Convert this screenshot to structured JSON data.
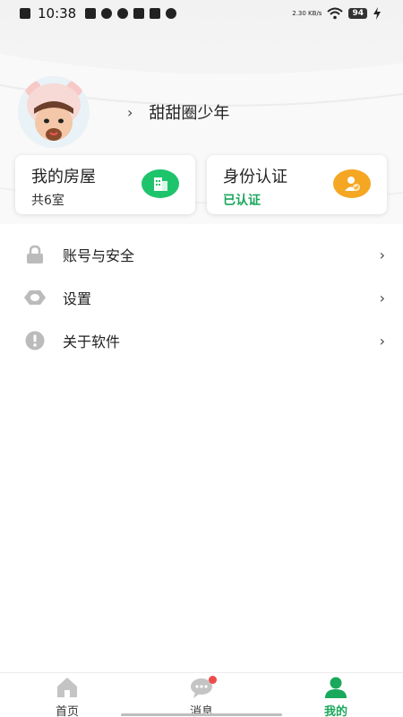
{
  "status_bar": {
    "time": "10:38",
    "net_speed": "2.30 KB/s",
    "battery": "94"
  },
  "profile": {
    "username": "甜甜圈少年",
    "chevron": "›"
  },
  "cards": {
    "house": {
      "title": "我的房屋",
      "subtitle": "共6室",
      "icon": "building-icon",
      "color": "#1ec46c"
    },
    "identity": {
      "title": "身份认证",
      "subtitle": "已认证",
      "icon": "user-verified-icon",
      "color": "#f5a623"
    }
  },
  "menu": {
    "items": [
      {
        "label": "账号与安全",
        "icon": "lock-icon",
        "chevron": "›"
      },
      {
        "label": "设置",
        "icon": "eye-settings-icon",
        "chevron": "›"
      },
      {
        "label": "关于软件",
        "icon": "info-icon",
        "chevron": "›"
      }
    ]
  },
  "tab_bar": {
    "tabs": [
      {
        "label": "首页",
        "icon": "home-icon"
      },
      {
        "label": "消息",
        "icon": "message-icon"
      },
      {
        "label": "我的",
        "icon": "person-icon",
        "active": true
      }
    ]
  },
  "colors": {
    "accent_green": "#1aa85c",
    "card_green": "#1ec46c",
    "card_orange": "#f5a623",
    "badge_red": "#f04b4b"
  }
}
